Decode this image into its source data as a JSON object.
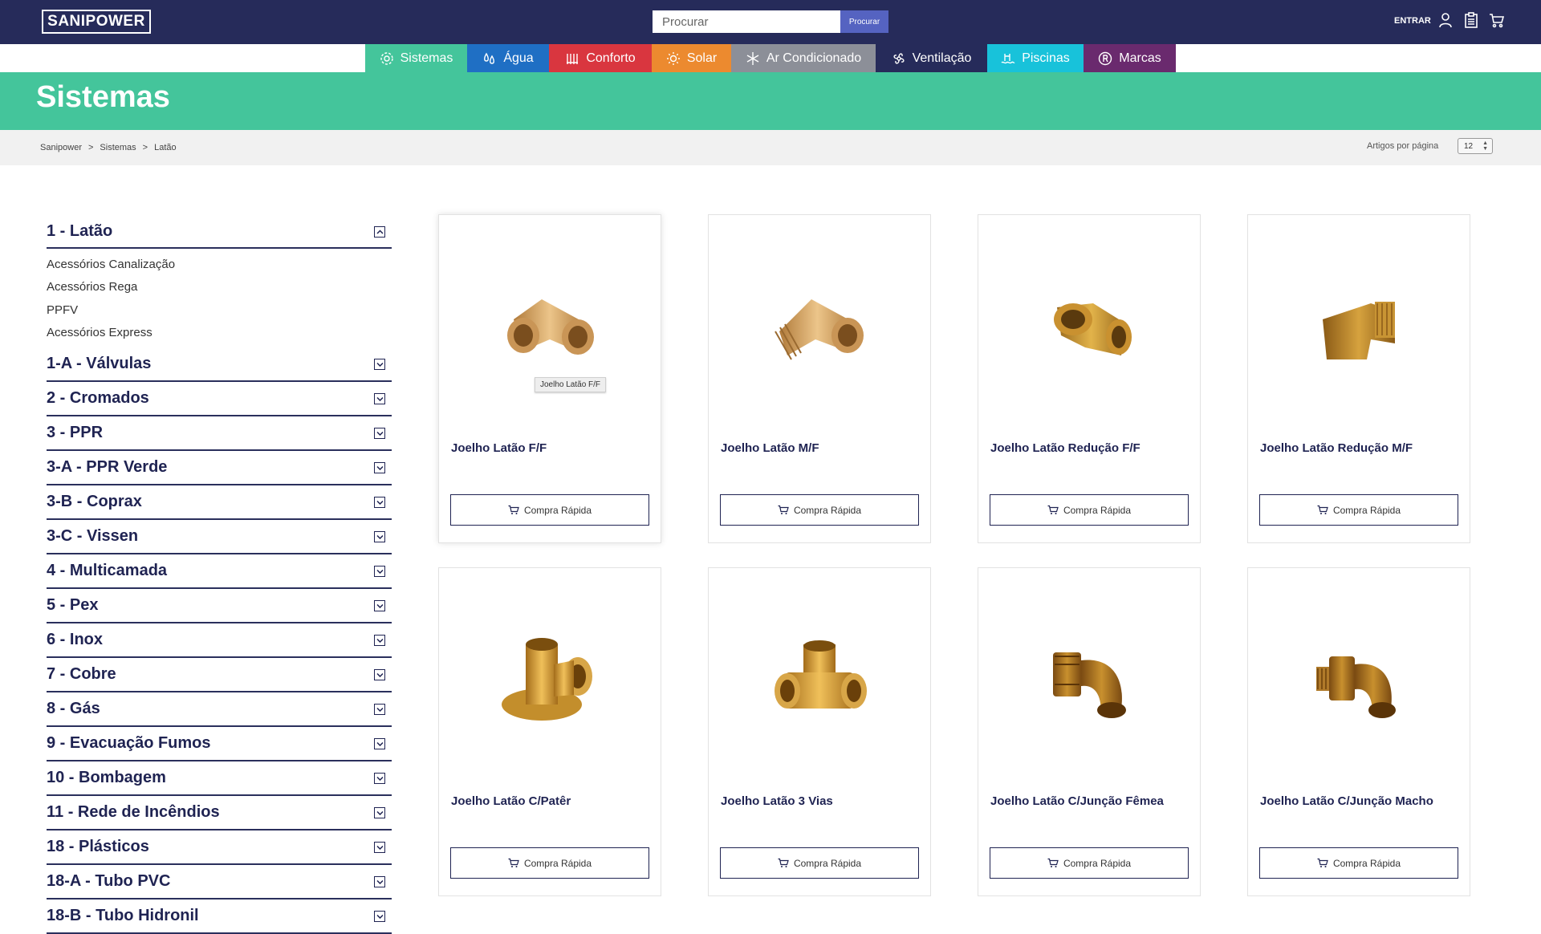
{
  "header": {
    "logo": "SANIPOWER",
    "search_placeholder": "Procurar",
    "search_button": "Procurar",
    "login_label": "ENTRAR"
  },
  "categories": [
    {
      "label": "Sistemas",
      "color": "#44c59b",
      "icon": "gear-icon"
    },
    {
      "label": "Água",
      "color": "#1f6fc4",
      "icon": "drops-icon"
    },
    {
      "label": "Conforto",
      "color": "#d9363f",
      "icon": "radiator-icon"
    },
    {
      "label": "Solar",
      "color": "#ec8a2f",
      "icon": "sun-icon"
    },
    {
      "label": "Ar Condicionado",
      "color": "#8c8f98",
      "icon": "snowflake-icon"
    },
    {
      "label": "Ventilação",
      "color": "#262b5a",
      "icon": "fan-icon"
    },
    {
      "label": "Piscinas",
      "color": "#18c2da",
      "icon": "pool-icon"
    },
    {
      "label": "Marcas",
      "color": "#6a2a6e",
      "icon": "registered-icon"
    }
  ],
  "hero": {
    "title": "Sistemas"
  },
  "breadcrumb": [
    "Sanipower",
    ">",
    "Sistemas",
    ">",
    "Latão"
  ],
  "per_page": {
    "label": "Artigos por página",
    "value": "12"
  },
  "sidebar": {
    "open_section": {
      "label": "1 - Latão",
      "items": [
        "Acessórios Canalização",
        "Acessórios Rega",
        "PPFV",
        "Acessórios Express"
      ]
    },
    "sections": [
      "1-A - Válvulas",
      "2 - Cromados",
      "3 - PPR",
      "3-A - PPR Verde",
      "3-B - Coprax",
      "3-C - Vissen",
      "4 - Multicamada",
      "5 - Pex",
      "6 - Inox",
      "7 - Cobre",
      "8 - Gás",
      "9 - Evacuação Fumos",
      "10 - Bombagem",
      "11 - Rede de Incêndios",
      "18 - Plásticos",
      "18-A - Tubo PVC",
      "18-B - Tubo Hidronil"
    ]
  },
  "products": [
    {
      "name": "Joelho Latão F/F",
      "button": "Compra Rápida",
      "tooltip": "Joelho Latão F/F"
    },
    {
      "name": "Joelho Latão M/F",
      "button": "Compra Rápida"
    },
    {
      "name": "Joelho Latão Redução F/F",
      "button": "Compra Rápida"
    },
    {
      "name": "Joelho Latão Redução M/F",
      "button": "Compra Rápida"
    },
    {
      "name": "Joelho Latão C/Patêr",
      "button": "Compra Rápida"
    },
    {
      "name": "Joelho Latão 3 Vias",
      "button": "Compra Rápida"
    },
    {
      "name": "Joelho Latão C/Junção Fêmea",
      "button": "Compra Rápida"
    },
    {
      "name": "Joelho Latão C/Junção Macho",
      "button": "Compra Rápida"
    }
  ]
}
